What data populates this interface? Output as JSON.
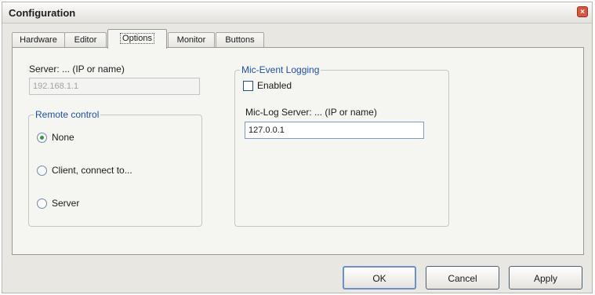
{
  "window": {
    "title": "Configuration",
    "close_label": "×"
  },
  "tabs": [
    {
      "label": "Hardware",
      "active": false
    },
    {
      "label": "Editor",
      "active": false
    },
    {
      "label": "Options",
      "active": true
    },
    {
      "label": "Monitor",
      "active": false
    },
    {
      "label": "Buttons",
      "active": false
    }
  ],
  "options": {
    "server_label": "Server: ... (IP or name)",
    "server_value": "192.168.1.1",
    "remote_control": {
      "title": "Remote control",
      "options": [
        {
          "label": "None",
          "checked": true
        },
        {
          "label": "Client, connect to...",
          "checked": false
        },
        {
          "label": "Server",
          "checked": false
        }
      ]
    },
    "mic_event_logging": {
      "title": "Mic-Event Logging",
      "enabled_label": "Enabled",
      "enabled_checked": false,
      "log_server_label": "Mic-Log Server: ... (IP or name)",
      "log_server_value": "127.0.0.1"
    }
  },
  "buttons": {
    "ok": "OK",
    "cancel": "Cancel",
    "apply": "Apply"
  }
}
